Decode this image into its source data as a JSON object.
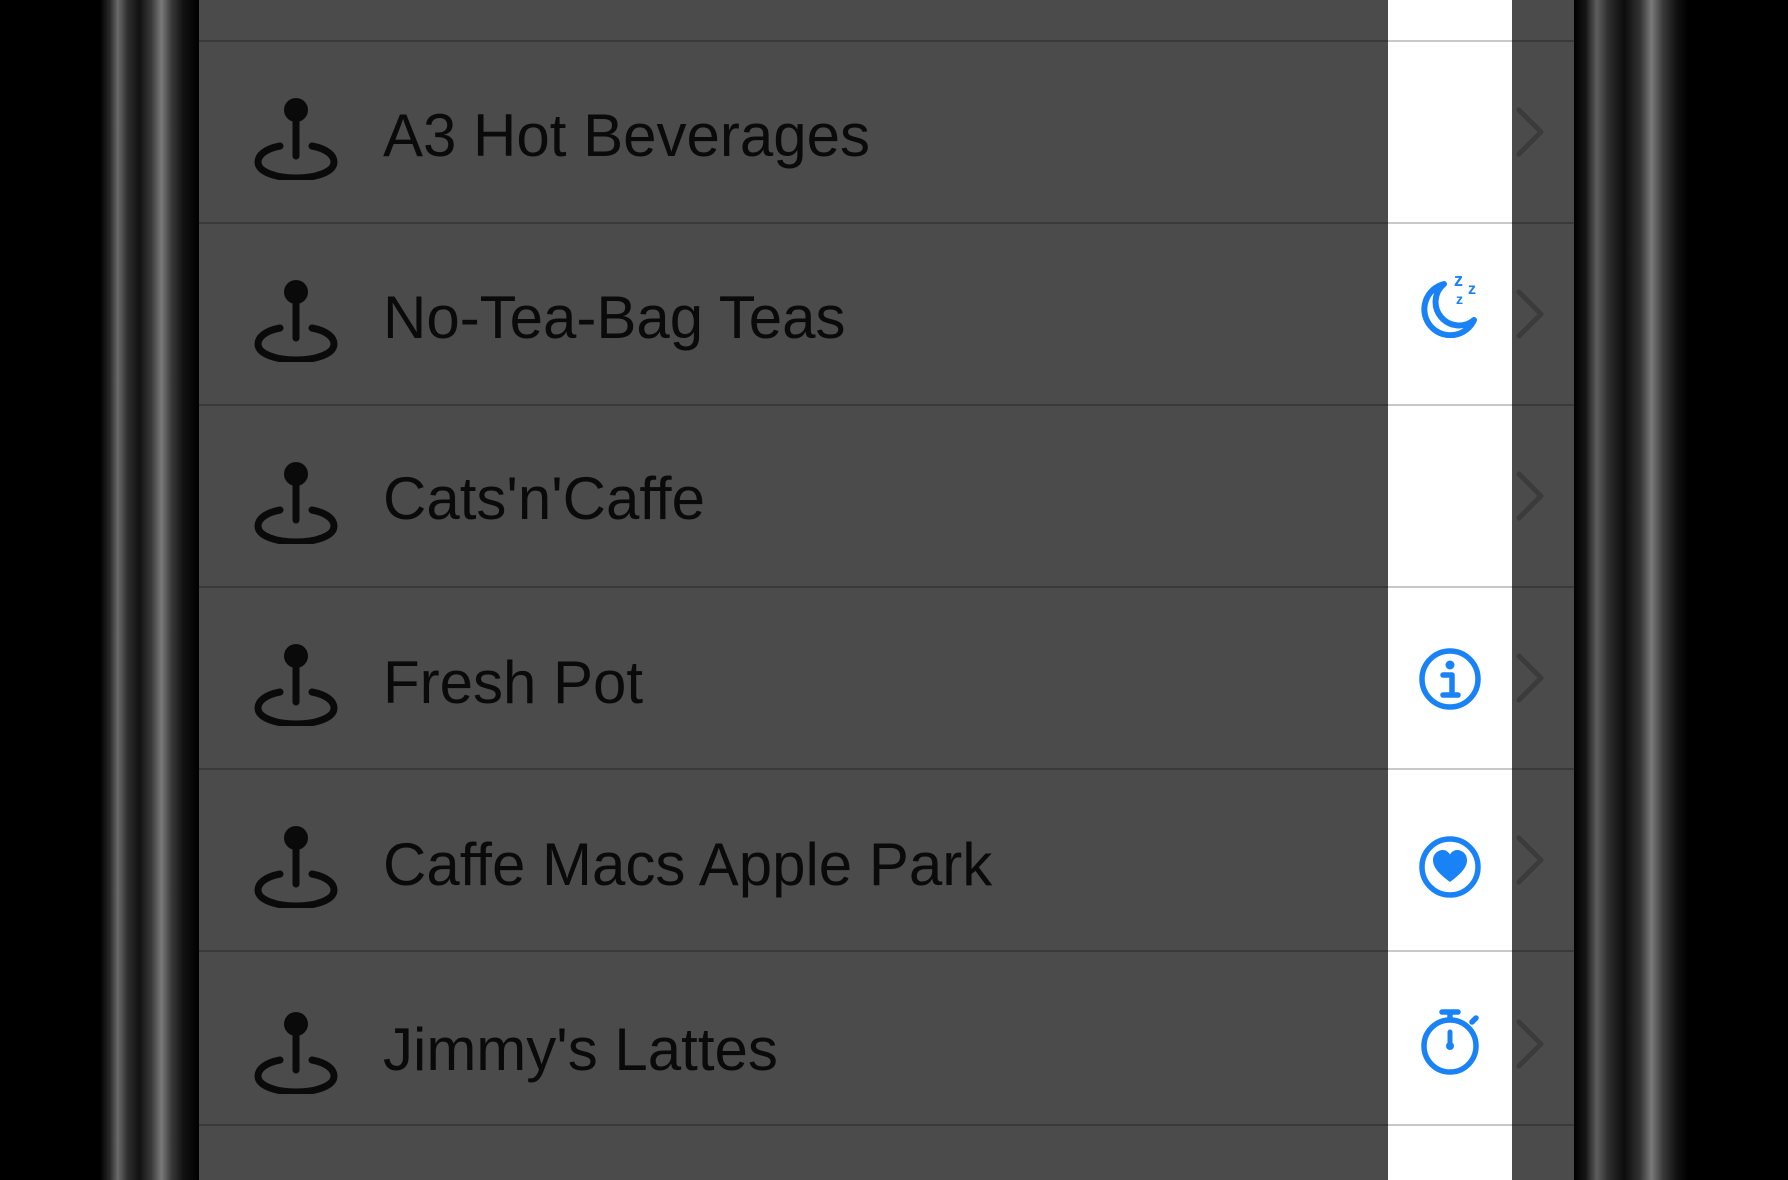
{
  "list": {
    "items": [
      {
        "name": "A3 Hot Beverages",
        "status_icon": null
      },
      {
        "name": "No-Tea-Bag Teas",
        "status_icon": "sleep-moon-icon"
      },
      {
        "name": "Cats'n'Caffe",
        "status_icon": null
      },
      {
        "name": "Fresh Pot",
        "status_icon": "info-icon"
      },
      {
        "name": "Caffe Macs Apple Park",
        "status_icon": "heart-circle-icon"
      },
      {
        "name": "Jimmy's Lattes",
        "status_icon": "stopwatch-icon"
      }
    ]
  },
  "colors": {
    "accent": "#1a82f7",
    "row_background": "#4b4b4b",
    "text": "#0a0a0a",
    "strip": "#ffffff"
  }
}
